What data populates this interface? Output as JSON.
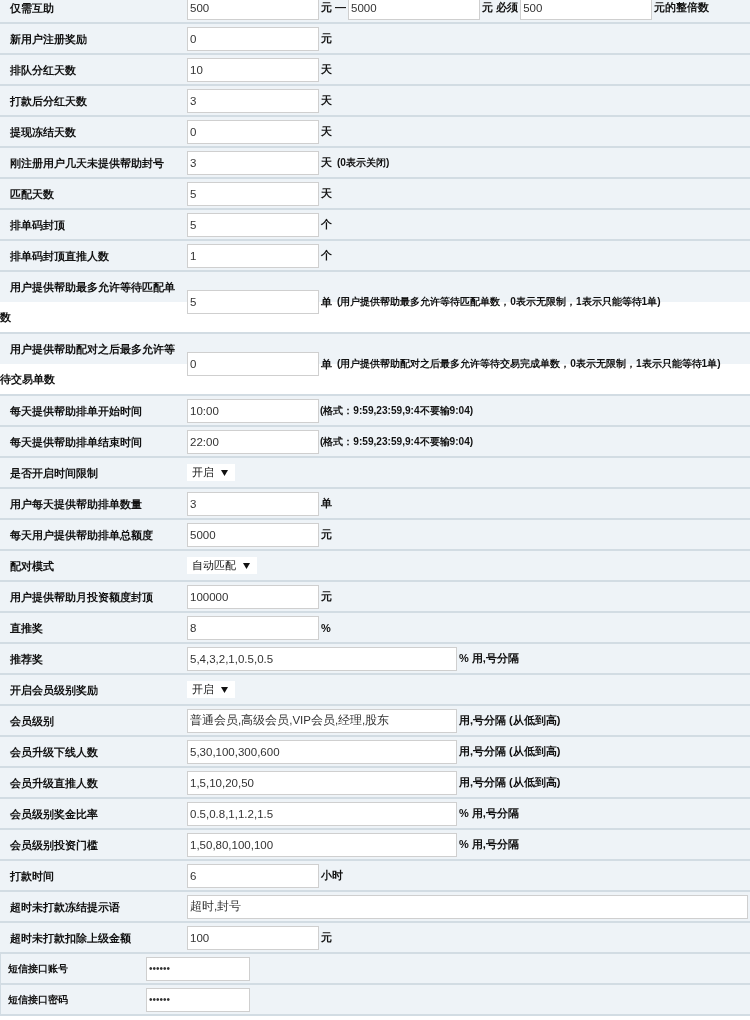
{
  "settings": [
    {
      "kind": "standard",
      "label": "仅需互助",
      "parts": [
        {
          "kind": "input",
          "value": "500"
        },
        {
          "kind": "unit",
          "text": "元 —"
        },
        {
          "kind": "input",
          "value": "5000"
        },
        {
          "kind": "unit",
          "text": "元 必须"
        },
        {
          "kind": "input",
          "value": "500"
        },
        {
          "kind": "unit",
          "text": "元的整倍数"
        }
      ]
    },
    {
      "kind": "standard",
      "label": "新用户注册奖励",
      "parts": [
        {
          "kind": "input",
          "value": "0"
        },
        {
          "kind": "unit",
          "text": "元"
        }
      ]
    },
    {
      "kind": "standard",
      "label": "排队分红天数",
      "parts": [
        {
          "kind": "input",
          "value": "10"
        },
        {
          "kind": "unit",
          "text": "天"
        }
      ]
    },
    {
      "kind": "standard",
      "label": "打款后分红天数",
      "parts": [
        {
          "kind": "input",
          "value": "3"
        },
        {
          "kind": "unit",
          "text": "天"
        }
      ]
    },
    {
      "kind": "standard",
      "label": "提现冻结天数",
      "parts": [
        {
          "kind": "input",
          "value": "0"
        },
        {
          "kind": "unit",
          "text": "天"
        }
      ]
    },
    {
      "kind": "standard",
      "label": "刚注册用户几天未提供帮助封号",
      "parts": [
        {
          "kind": "input",
          "value": "3"
        },
        {
          "kind": "unit",
          "text": "天"
        },
        {
          "kind": "note",
          "text": "(0表示关闭)"
        }
      ]
    },
    {
      "kind": "standard",
      "label": "匹配天数",
      "parts": [
        {
          "kind": "input",
          "value": "5"
        },
        {
          "kind": "unit",
          "text": "天"
        }
      ]
    },
    {
      "kind": "standard",
      "label": "排单码封顶",
      "parts": [
        {
          "kind": "input",
          "value": "5"
        },
        {
          "kind": "unit",
          "text": "个"
        }
      ]
    },
    {
      "kind": "standard",
      "label": "排单码封顶直推人数",
      "parts": [
        {
          "kind": "input",
          "value": "1"
        },
        {
          "kind": "unit",
          "text": "个"
        }
      ]
    },
    {
      "kind": "wrapped",
      "label": "用户提供帮助最多允许等待匹配单数",
      "parts": [
        {
          "kind": "input",
          "value": "5"
        },
        {
          "kind": "unit",
          "text": "单"
        },
        {
          "kind": "note",
          "text": "(用户提供帮助最多允许等待匹配单数，0表示无限制，1表示只能等待1单)"
        }
      ]
    },
    {
      "kind": "wrapped",
      "label": "用户提供帮助配对之后最多允许等待交易单数",
      "parts": [
        {
          "kind": "input",
          "value": "0"
        },
        {
          "kind": "unit",
          "text": "单"
        },
        {
          "kind": "note",
          "text": "(用户提供帮助配对之后最多允许等待交易完成单数，0表示无限制，1表示只能等待1单)"
        }
      ]
    },
    {
      "kind": "standard",
      "label": "每天提供帮助排单开始时间",
      "parts": [
        {
          "kind": "input",
          "value": "10:00"
        },
        {
          "kind": "note",
          "text": "(格式：9:59,23:59,9:4不要输9:04)"
        }
      ]
    },
    {
      "kind": "standard",
      "label": "每天提供帮助排单结束时间",
      "parts": [
        {
          "kind": "input",
          "value": "22:00"
        },
        {
          "kind": "note",
          "text": "(格式：9:59,23:59,9:4不要输9:04)"
        }
      ]
    },
    {
      "kind": "standard",
      "label": "是否开启时间限制",
      "parts": [
        {
          "kind": "select",
          "value": "开启"
        }
      ]
    },
    {
      "kind": "standard",
      "label": "用户每天提供帮助排单数量",
      "parts": [
        {
          "kind": "input",
          "value": "3"
        },
        {
          "kind": "unit",
          "text": "单"
        }
      ]
    },
    {
      "kind": "standard",
      "label": "每天用户提供帮助排单总额度",
      "parts": [
        {
          "kind": "input",
          "value": "5000"
        },
        {
          "kind": "unit",
          "text": "元"
        }
      ]
    },
    {
      "kind": "standard",
      "label": "配对模式",
      "parts": [
        {
          "kind": "select",
          "value": "自动匹配"
        }
      ]
    },
    {
      "kind": "standard",
      "label": "用户提供帮助月投资额度封顶",
      "parts": [
        {
          "kind": "input",
          "value": "100000"
        },
        {
          "kind": "unit",
          "text": "元"
        }
      ]
    },
    {
      "kind": "standard",
      "label": "直推奖",
      "parts": [
        {
          "kind": "input",
          "value": "8"
        },
        {
          "kind": "unit",
          "text": "%"
        }
      ]
    },
    {
      "kind": "standard",
      "label": "推荐奖",
      "parts": [
        {
          "kind": "long_input",
          "value": "5,4,3,2,1,0.5,0.5"
        },
        {
          "kind": "unit",
          "text": "% 用,号分隔"
        }
      ]
    },
    {
      "kind": "standard",
      "label": "开启会员级别奖励",
      "parts": [
        {
          "kind": "select",
          "value": "开启"
        }
      ]
    },
    {
      "kind": "standard",
      "label": "会员级别",
      "parts": [
        {
          "kind": "long_input",
          "value": "普通会员,高级会员,VIP会员,经理,股东"
        },
        {
          "kind": "unit",
          "text": "用,号分隔 (从低到高)"
        }
      ]
    },
    {
      "kind": "standard",
      "label": "会员升级下线人数",
      "parts": [
        {
          "kind": "long_input",
          "value": "5,30,100,300,600"
        },
        {
          "kind": "unit",
          "text": "用,号分隔 (从低到高)"
        }
      ]
    },
    {
      "kind": "standard",
      "label": "会员升级直推人数",
      "parts": [
        {
          "kind": "long_input",
          "value": "1,5,10,20,50"
        },
        {
          "kind": "unit",
          "text": "用,号分隔 (从低到高)"
        }
      ]
    },
    {
      "kind": "standard",
      "label": "会员级别奖金比率",
      "parts": [
        {
          "kind": "long_input",
          "value": "0.5,0.8,1,1.2,1.5"
        },
        {
          "kind": "unit",
          "text": "% 用,号分隔"
        }
      ]
    },
    {
      "kind": "standard",
      "label": "会员级别投资门槛",
      "parts": [
        {
          "kind": "long_input",
          "value": "1,50,80,100,100"
        },
        {
          "kind": "unit",
          "text": "% 用,号分隔"
        }
      ]
    },
    {
      "kind": "standard",
      "label": "打款时间",
      "parts": [
        {
          "kind": "input",
          "value": "6"
        },
        {
          "kind": "unit",
          "text": "小时"
        }
      ]
    },
    {
      "kind": "standard",
      "label": "超时未打款冻结提示语",
      "parts": [
        {
          "kind": "full_input",
          "value": "超时,封号"
        }
      ]
    },
    {
      "kind": "standard",
      "label": "超时未打款扣除上级金额",
      "parts": [
        {
          "kind": "input",
          "value": "100"
        },
        {
          "kind": "unit",
          "text": "元"
        }
      ]
    },
    {
      "kind": "compact",
      "label": "短信接口账号",
      "parts": [
        {
          "kind": "secret_input",
          "value": "••••••"
        }
      ]
    },
    {
      "kind": "compact",
      "label": "短信接口密码",
      "parts": [
        {
          "kind": "secret_input",
          "value": "••••••"
        }
      ]
    }
  ]
}
